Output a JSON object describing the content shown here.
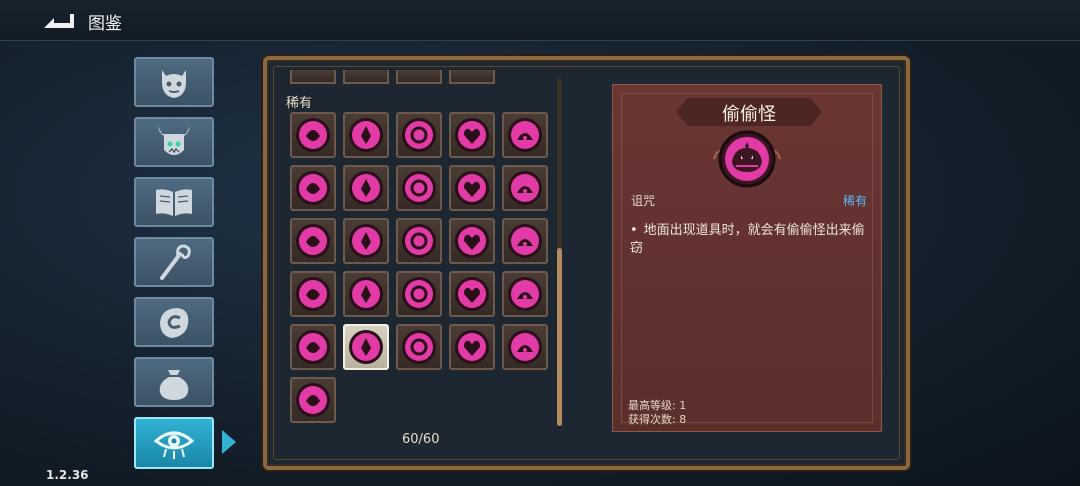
{
  "header": {
    "title": "图鉴",
    "back_icon": "back-arrow-icon"
  },
  "version": "1.2.36",
  "sidebar": {
    "tabs": [
      {
        "name": "monster",
        "icon": "monster-face-icon",
        "active": false
      },
      {
        "name": "boss",
        "icon": "horned-demon-icon",
        "active": false
      },
      {
        "name": "lore",
        "icon": "open-book-icon",
        "active": false
      },
      {
        "name": "weapon",
        "icon": "staff-icon",
        "active": false
      },
      {
        "name": "relic",
        "icon": "rune-hand-icon",
        "active": false
      },
      {
        "name": "item",
        "icon": "pouch-icon",
        "active": false
      },
      {
        "name": "curse",
        "icon": "eye-icon",
        "active": true
      }
    ]
  },
  "grid": {
    "section_label": "稀有",
    "count": "60/60",
    "selected_index": 21,
    "icon_color": "#e23aa6",
    "icons": [
      "curse-icon-1",
      "curse-icon-2",
      "curse-icon-3",
      "curse-icon-4",
      "curse-icon-5",
      "curse-icon-6",
      "curse-icon-7",
      "curse-icon-8",
      "curse-icon-9",
      "curse-icon-10",
      "curse-icon-11",
      "curse-icon-12",
      "curse-icon-13",
      "curse-icon-14",
      "curse-icon-15",
      "curse-icon-16",
      "curse-icon-17",
      "curse-icon-18",
      "curse-icon-19",
      "curse-icon-20",
      "curse-icon-21",
      "thief-monster-icon",
      "treasure-chest-icon",
      "curse-icon-24",
      "curse-icon-25",
      "curse-icon-26"
    ]
  },
  "detail": {
    "name": "偷偷怪",
    "category": "诅咒",
    "rarity": "稀有",
    "rarity_color": "#5fb5ef",
    "description": "地面出现道具时，就会有偷偷怪出来偷窃",
    "bullet": "•",
    "max_level_text": "最高等级: 1",
    "obtained_text": "获得次数: 8"
  }
}
